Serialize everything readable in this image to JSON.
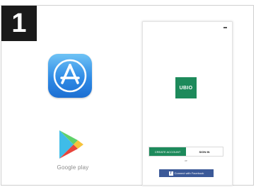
{
  "step": {
    "number": "1"
  },
  "stores": {
    "appstore": {
      "icon": "app-store-icon"
    },
    "googleplay": {
      "icon": "google-play-icon",
      "label": "Google play"
    }
  },
  "phone": {
    "logo_text": "UBIO",
    "buttons": {
      "create_label": "CREATE ACCOUNT",
      "signin_label": "SIGN IN"
    },
    "or_text": "or",
    "facebook_label": "Connect with Facebook",
    "facebook_icon": "f"
  },
  "colors": {
    "brand": "#1d8a5b",
    "facebook": "#3b5998",
    "badge": "#1a1a1a"
  }
}
